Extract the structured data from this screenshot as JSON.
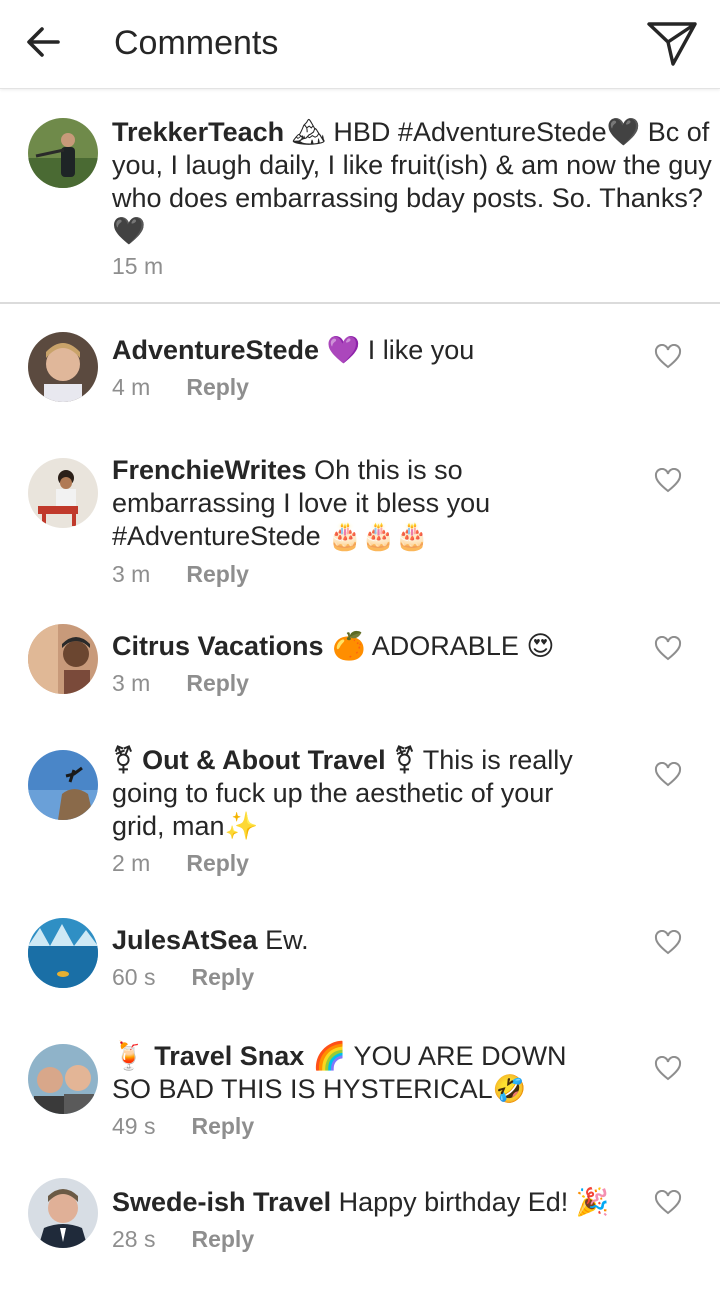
{
  "header": {
    "title": "Comments",
    "back_icon": "arrow-left-icon",
    "share_icon": "paper-plane-icon"
  },
  "caption": {
    "username": "TrekkerTeach",
    "text_part1": " HBD #AdventureStede",
    "text_part2": " Bc of you, I laugh daily, I like fruit(ish) & am now the guy who does embarrassing bday posts. So. Thanks? ",
    "emoji_mountain": "🏔",
    "emoji_heart": "🖤",
    "emoji_heart_end": "🖤",
    "time": "15 m"
  },
  "reply_label": "Reply",
  "comments": [
    {
      "username": "AdventureStede",
      "pre": "",
      "emoji_a": "💜",
      "text": " I like you",
      "emoji_b": "",
      "time": "4 m"
    },
    {
      "username": "FrenchieWrites",
      "pre": "",
      "emoji_a": "",
      "text": " Oh this is so embarrassing I love it bless you #AdventureStede ",
      "emoji_b": "🎂🎂🎂",
      "time": "3 m"
    },
    {
      "username": "Citrus Vacations",
      "pre": "",
      "emoji_a": " 🍊",
      "text": " ADORABLE ",
      "emoji_b": "😍",
      "time": "3 m"
    },
    {
      "username": "⚧ Out & About Travel ⚧",
      "pre": "",
      "emoji_a": "",
      "text": " This is really going to fuck up the aesthetic of your grid, man",
      "emoji_b": "✨",
      "time": "2 m"
    },
    {
      "username": "JulesAtSea",
      "pre": "",
      "emoji_a": "",
      "text": " Ew.",
      "emoji_b": "",
      "time": "60 s"
    },
    {
      "username": "Travel Snax",
      "pre": "🍹 ",
      "emoji_a": " 🌈",
      "text": " YOU ARE DOWN SO BAD THIS IS HYSTERICAL",
      "emoji_b": "🤣",
      "time": "49 s"
    },
    {
      "username": "Swede-ish Travel",
      "pre": "",
      "emoji_a": "",
      "text": " Happy birthday Ed! ",
      "emoji_b": "🎉",
      "time": "28 s"
    }
  ],
  "icons": {
    "heart": "heart-outline-icon"
  }
}
